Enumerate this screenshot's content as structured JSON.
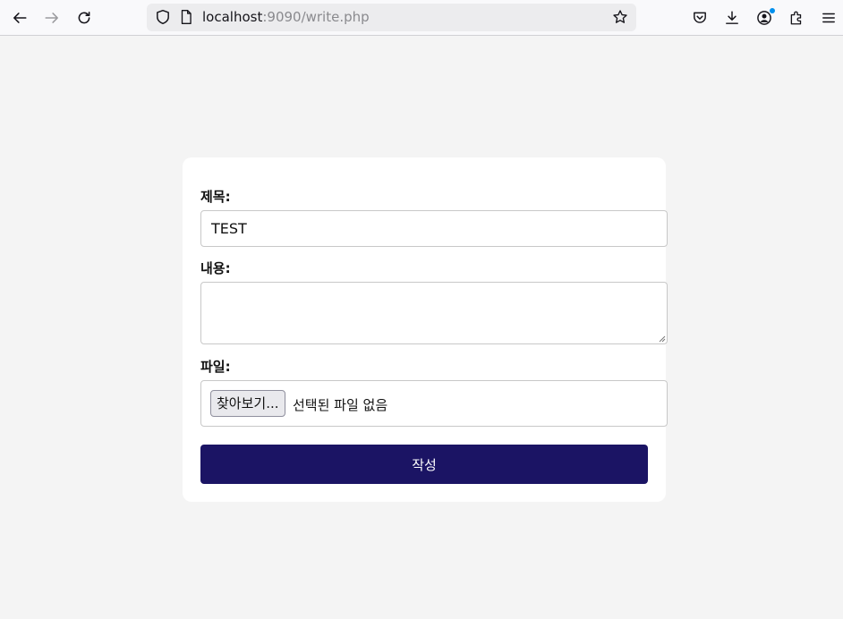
{
  "browser": {
    "url_host": "localhost",
    "url_rest": ":9090/write.php",
    "icons": [
      "back-icon",
      "forward-icon",
      "reload-icon",
      "shield-icon",
      "page-icon",
      "bookmark-star-icon",
      "pocket-icon",
      "download-icon",
      "account-icon",
      "extensions-icon",
      "menu-icon"
    ]
  },
  "form": {
    "title_label": "제목:",
    "title_value": "TEST",
    "content_label": "내용:",
    "content_value": "",
    "file_label": "파일:",
    "file_button": "찾아보기...",
    "file_status": "선택된 파일 없음",
    "submit_label": "작성"
  },
  "colors": {
    "page_bg": "#f4f4f4",
    "card_bg": "#ffffff",
    "submit_bg": "#1b1464",
    "notification_dot": "#0090ed"
  }
}
